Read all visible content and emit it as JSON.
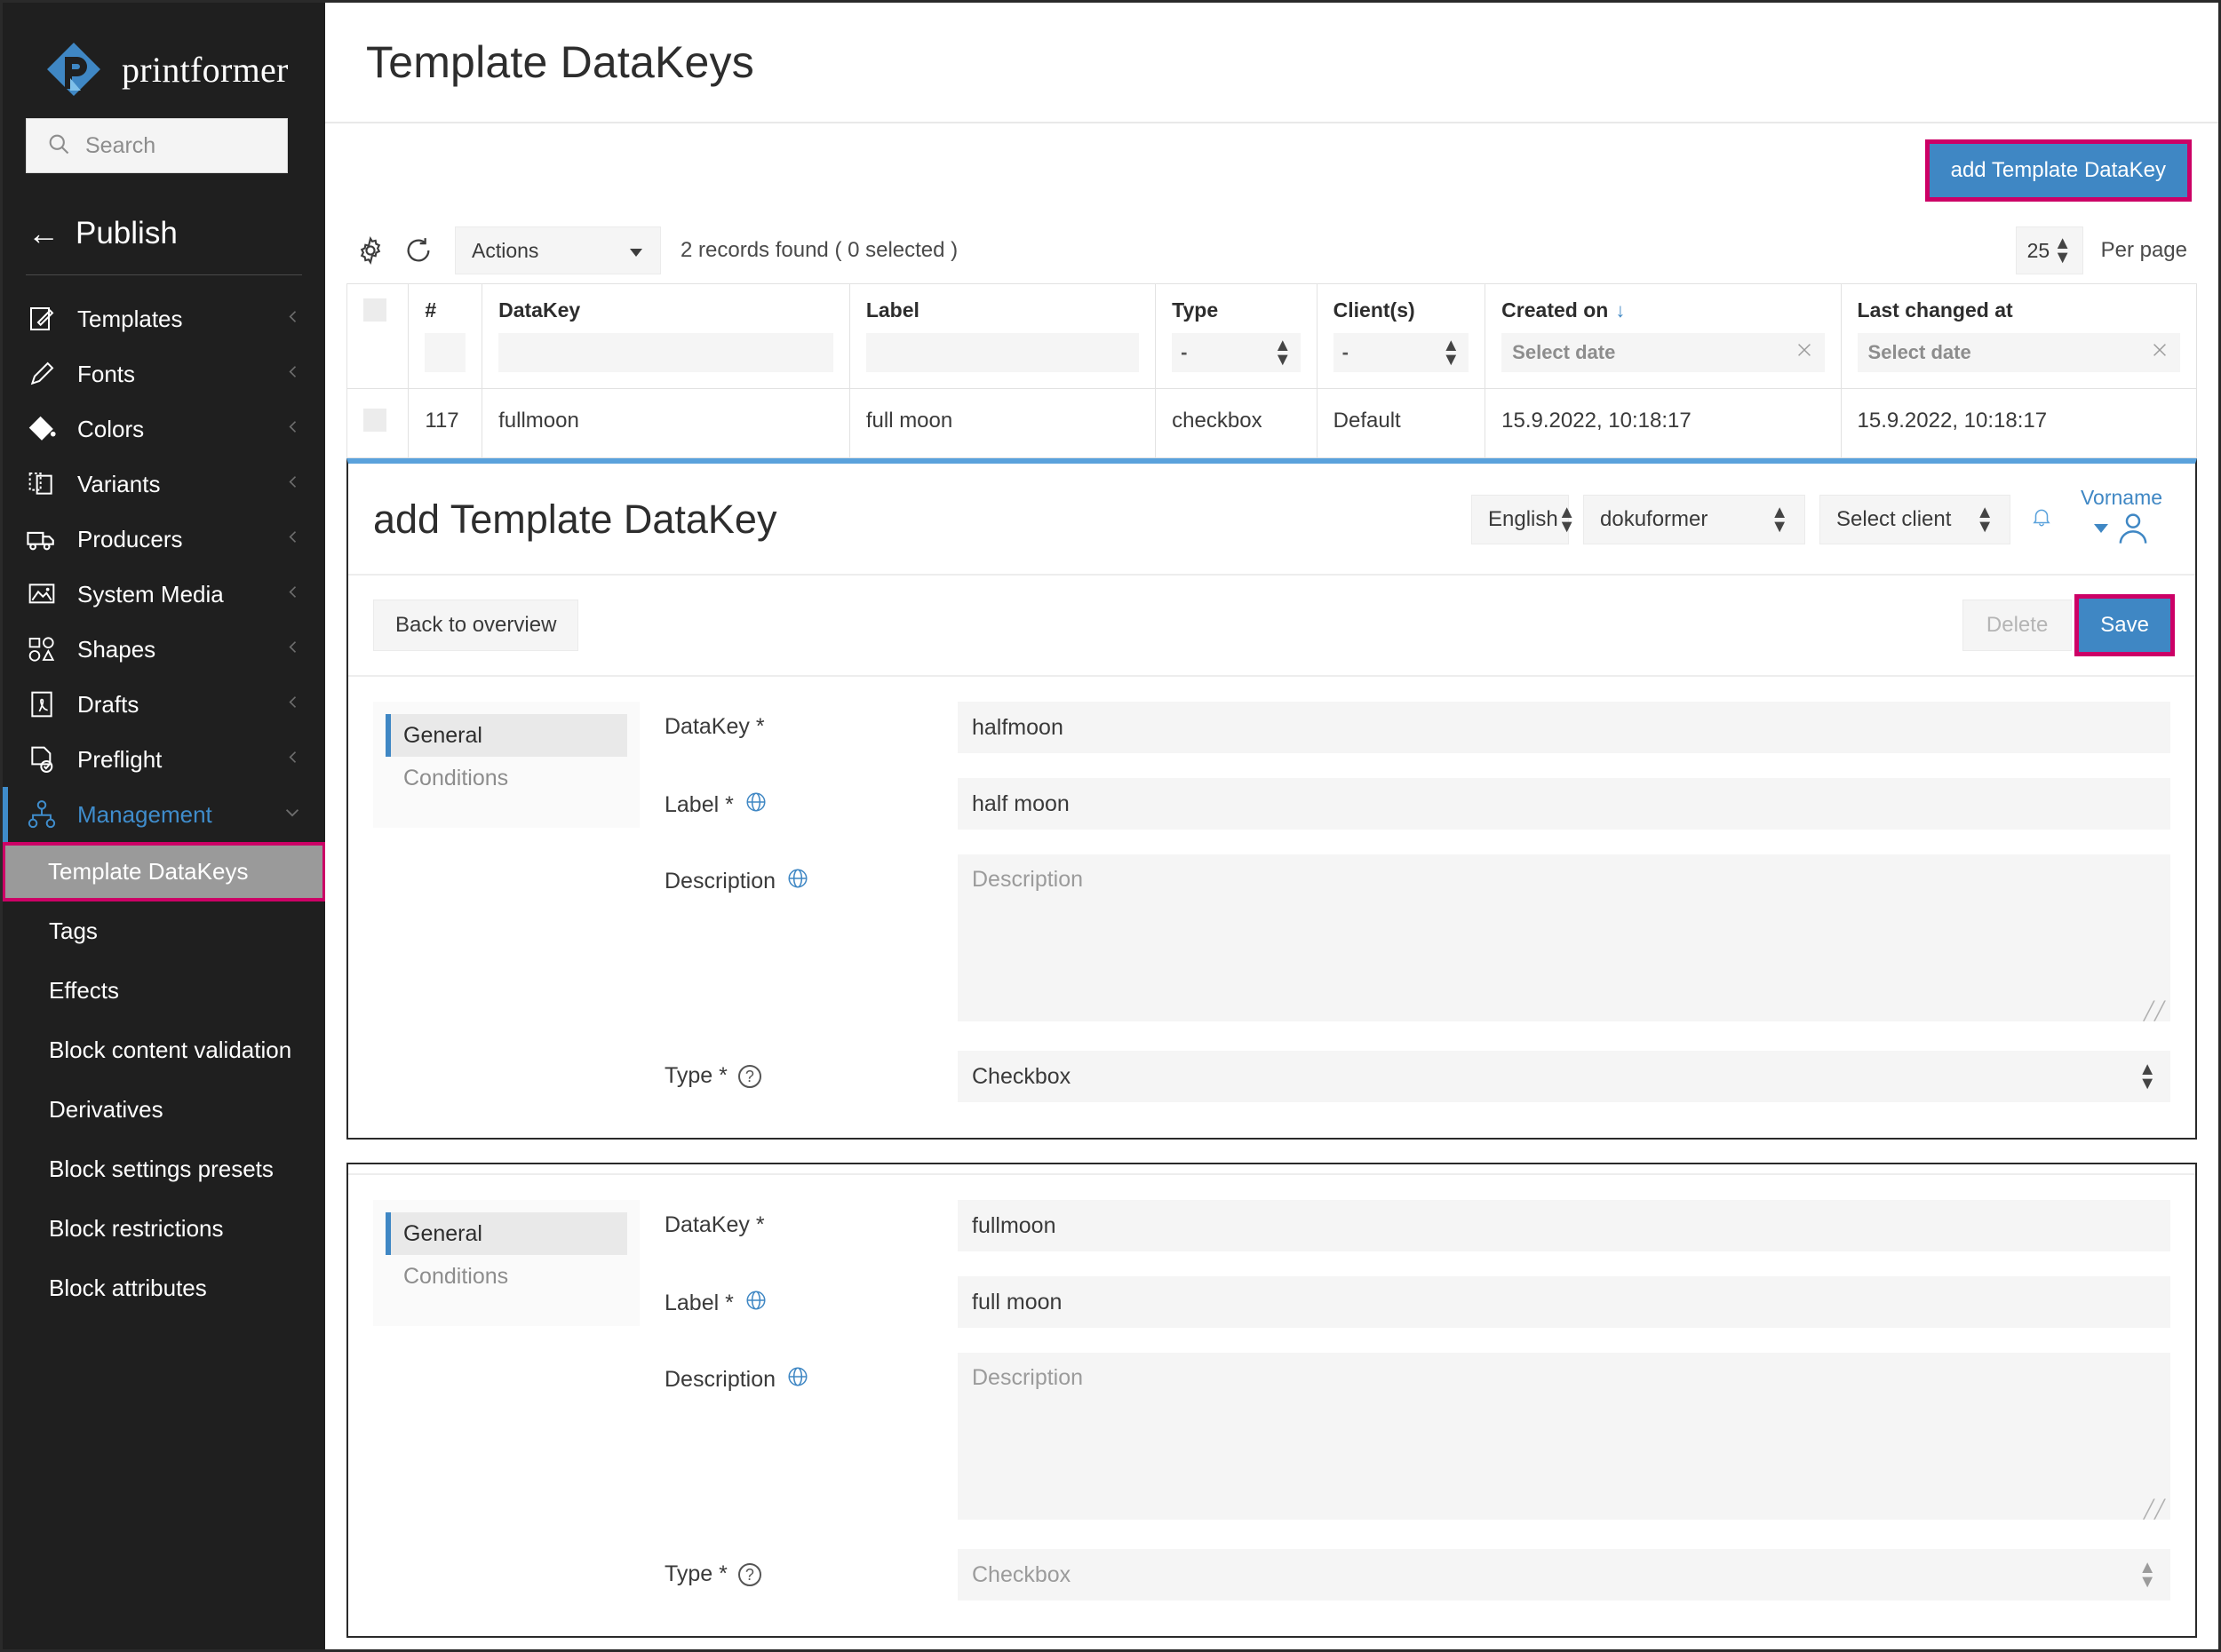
{
  "brand": {
    "name": "printformer"
  },
  "search": {
    "placeholder": "Search",
    "value": ""
  },
  "publish": {
    "label": "Publish",
    "arrow": "←"
  },
  "sidebar": {
    "items": [
      {
        "label": "Templates",
        "icon": "template-icon"
      },
      {
        "label": "Fonts",
        "icon": "pen-icon"
      },
      {
        "label": "Colors",
        "icon": "paint-bucket-icon"
      },
      {
        "label": "Variants",
        "icon": "variants-icon"
      },
      {
        "label": "Producers",
        "icon": "truck-icon"
      },
      {
        "label": "System Media",
        "icon": "image-icon"
      },
      {
        "label": "Shapes",
        "icon": "shapes-icon"
      },
      {
        "label": "Drafts",
        "icon": "pdf-icon"
      },
      {
        "label": "Preflight",
        "icon": "preflight-icon"
      },
      {
        "label": "Management",
        "icon": "management-icon"
      }
    ],
    "submenu": [
      {
        "label": "Template DataKeys",
        "selected": true
      },
      {
        "label": "Tags",
        "selected": false
      },
      {
        "label": "Effects",
        "selected": false
      },
      {
        "label": "Block content validation",
        "selected": false
      },
      {
        "label": "Derivatives",
        "selected": false
      },
      {
        "label": "Block settings presets",
        "selected": false
      },
      {
        "label": "Block restrictions",
        "selected": false
      },
      {
        "label": "Block attributes",
        "selected": false
      }
    ]
  },
  "page": {
    "title": "Template DataKeys"
  },
  "topbar": {
    "add_button": "add Template DataKey"
  },
  "toolbar": {
    "gear_icon": "gear-icon",
    "refresh_icon": "refresh-icon",
    "actions_label": "Actions",
    "records_text": "2 records found ( 0 selected )",
    "per_page_value": "25",
    "per_page_label": "Per page"
  },
  "table": {
    "columns": [
      {
        "key": "select",
        "label": ""
      },
      {
        "key": "num",
        "label": "#"
      },
      {
        "key": "datakey",
        "label": "DataKey"
      },
      {
        "key": "label",
        "label": "Label"
      },
      {
        "key": "type",
        "label": "Type"
      },
      {
        "key": "clients",
        "label": "Client(s)"
      },
      {
        "key": "created",
        "label": "Created on",
        "sorted": "↓"
      },
      {
        "key": "changed",
        "label": "Last changed at"
      }
    ],
    "filters": {
      "num": "",
      "datakey": "",
      "label": "",
      "type": "-",
      "clients": "-",
      "created_placeholder": "Select date",
      "changed_placeholder": "Select date"
    },
    "rows": [
      {
        "num": "117",
        "datakey": "fullmoon",
        "label": "full moon",
        "type": "checkbox",
        "clients": "Default",
        "created": "15.9.2022, 10:18:17",
        "changed": "15.9.2022, 10:18:17"
      }
    ]
  },
  "detail": {
    "title": "add Template DataKey",
    "language": "English",
    "tenant": "dokuformer",
    "client": "Select client",
    "user_name": "Vorname",
    "back_button": "Back to overview",
    "delete_button": "Delete",
    "save_button": "Save",
    "tabs": [
      {
        "label": "General",
        "active": true
      },
      {
        "label": "Conditions",
        "active": false
      }
    ],
    "fields": {
      "datakey_label": "DataKey *",
      "datakey_value": "halfmoon",
      "label_label": "Label *",
      "label_value": "half moon",
      "description_label": "Description",
      "description_value": "",
      "description_placeholder": "Description",
      "type_label": "Type *",
      "type_value": "Checkbox"
    }
  },
  "detail2": {
    "tabs": [
      {
        "label": "General",
        "active": true
      },
      {
        "label": "Conditions",
        "active": false
      }
    ],
    "fields": {
      "datakey_label": "DataKey *",
      "datakey_value": "fullmoon",
      "label_label": "Label *",
      "label_value": "full moon",
      "description_label": "Description",
      "description_value": "",
      "description_placeholder": "Description",
      "type_label": "Type *",
      "type_value": "Checkbox"
    }
  },
  "colors": {
    "accent_blue": "#3f87c4",
    "highlight_pink": "#cc0066",
    "sidebar_bg": "#1f1f1f",
    "panel_border_blue": "#5aa2dc"
  }
}
